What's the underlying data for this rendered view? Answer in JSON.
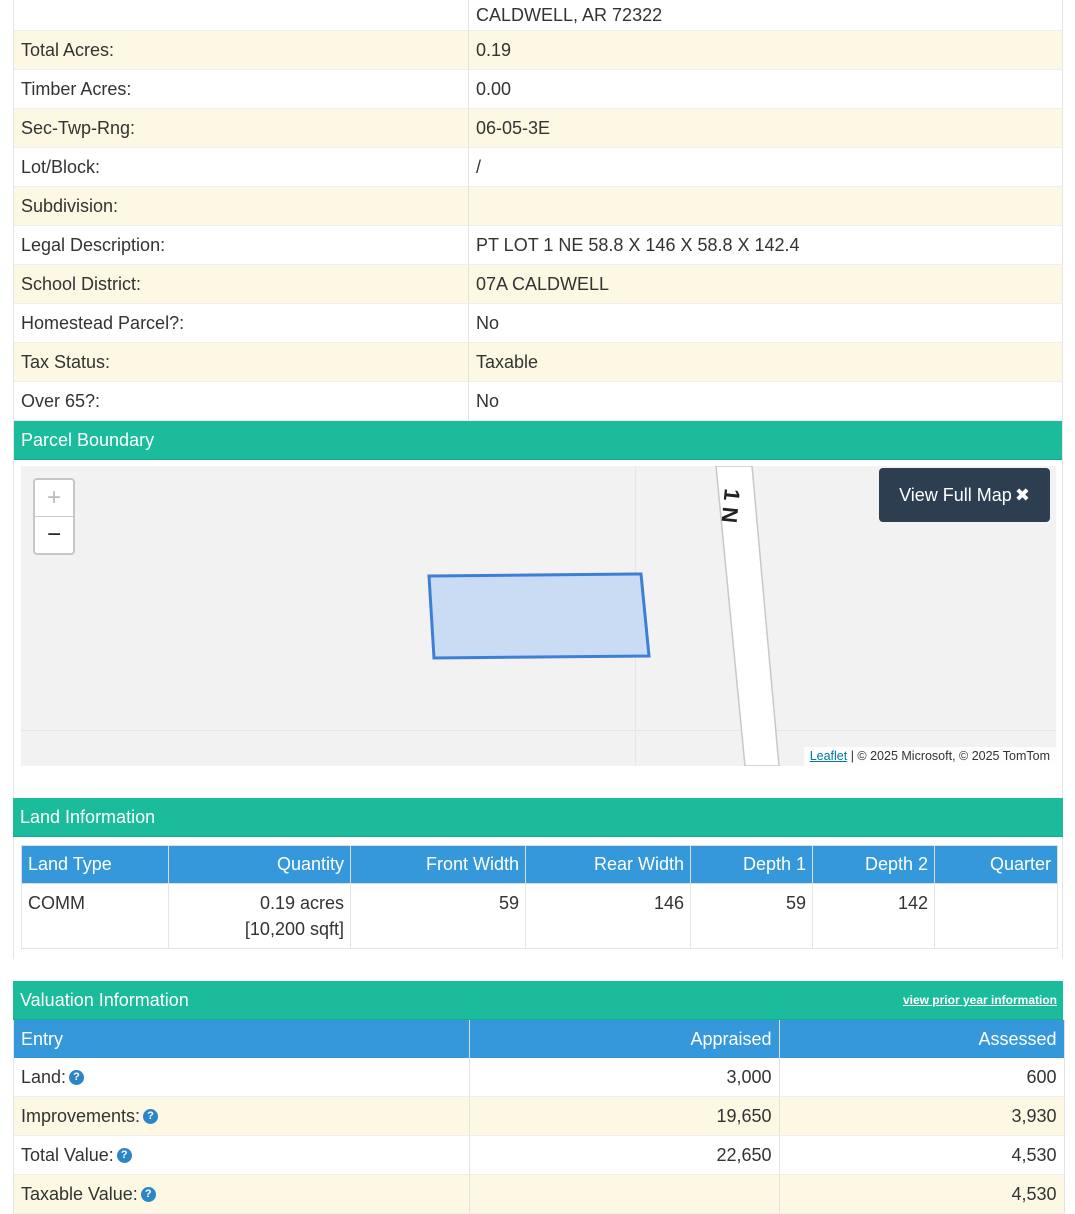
{
  "property": {
    "address_line": "CALDWELL, AR 72322",
    "rows": [
      {
        "label": "Total Acres:",
        "value": "0.19"
      },
      {
        "label": "Timber Acres:",
        "value": "0.00"
      },
      {
        "label": "Sec-Twp-Rng:",
        "value": "06-05-3E"
      },
      {
        "label": "Lot/Block:",
        "value": "/"
      },
      {
        "label": "Subdivision:",
        "value": ""
      },
      {
        "label": "Legal Description:",
        "value": "PT LOT 1 NE 58.8 X 146 X 58.8 X 142.4"
      },
      {
        "label": "School District:",
        "value": "07A CALDWELL"
      },
      {
        "label": "Homestead Parcel?:",
        "value": "No"
      },
      {
        "label": "Tax Status:",
        "value": "Taxable"
      },
      {
        "label": "Over 65?:",
        "value": "No"
      }
    ]
  },
  "parcel_boundary": {
    "title": "Parcel Boundary",
    "zoom_in": "+",
    "zoom_out": "−",
    "full_map_label": "View Full Map",
    "full_map_icon": "expand-icon",
    "road_label": "1 N",
    "attribution_link": "Leaflet",
    "attribution_text": " | © 2025 Microsoft, © 2025 TomTom",
    "colors": {
      "parcel_fill": "#c9dcf3",
      "parcel_stroke": "#3d7fd6"
    }
  },
  "land": {
    "title": "Land Information",
    "headers": [
      "Land Type",
      "Quantity",
      "Front Width",
      "Rear Width",
      "Depth 1",
      "Depth 2",
      "Quarter"
    ],
    "rows": [
      {
        "land_type": "COMM",
        "quantity_1": "0.19 acres",
        "quantity_2": "[10,200 sqft]",
        "front_width": "59",
        "rear_width": "146",
        "depth1": "59",
        "depth2": "142",
        "quarter": ""
      }
    ]
  },
  "valuation": {
    "title": "Valuation Information",
    "prior_year_link": "view prior year information",
    "headers": [
      "Entry",
      "Appraised",
      "Assessed"
    ],
    "help_icon": "question-circle-icon",
    "rows": [
      {
        "entry": "Land:",
        "appraised": "3,000",
        "assessed": "600"
      },
      {
        "entry": "Improvements:",
        "appraised": "19,650",
        "assessed": "3,930"
      },
      {
        "entry": "Total Value:",
        "appraised": "22,650",
        "assessed": "4,530"
      },
      {
        "entry": "Taxable Value:",
        "appraised": "",
        "assessed": "4,530"
      }
    ]
  },
  "colors": {
    "section_header": "#1abc9c",
    "table_header": "#3498db",
    "stripe": "#fcf8e3",
    "button": "#2c3e50"
  }
}
